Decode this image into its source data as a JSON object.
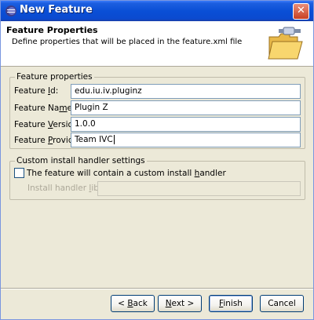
{
  "window": {
    "title": "New Feature",
    "close_glyph": "✕"
  },
  "banner": {
    "title": "Feature Properties",
    "description": "Define properties that will be placed in the feature.xml file"
  },
  "feature_properties": {
    "group_label": "Feature properties",
    "id": {
      "label_pre": "Feature ",
      "label_mn": "I",
      "label_post": "d:",
      "value": "edu.iu.iv.pluginz"
    },
    "name": {
      "label_pre": "Feature Na",
      "label_mn": "m",
      "label_post": "e:",
      "value": "Plugin Z"
    },
    "version": {
      "label_pre": "Feature ",
      "label_mn": "V",
      "label_post": "ersion:",
      "value": "1.0.0"
    },
    "provider": {
      "label_pre": "Feature ",
      "label_mn": "P",
      "label_post": "rovider:",
      "value": "Team IVC"
    }
  },
  "custom_install": {
    "group_label": "Custom install handler settings",
    "checkbox_label_pre": "The feature will contain a custom install ",
    "checkbox_label_mn": "h",
    "checkbox_label_post": "andler",
    "library_label_pre": "Install handler ",
    "library_label_mn": "l",
    "library_label_post": "ibrary:",
    "library_value": ""
  },
  "buttons": {
    "back_pre": "< ",
    "back_mn": "B",
    "back_post": "ack",
    "next_pre": "",
    "next_mn": "N",
    "next_post": "ext >",
    "finish_pre": "",
    "finish_mn": "F",
    "finish_post": "inish",
    "cancel": "Cancel"
  }
}
